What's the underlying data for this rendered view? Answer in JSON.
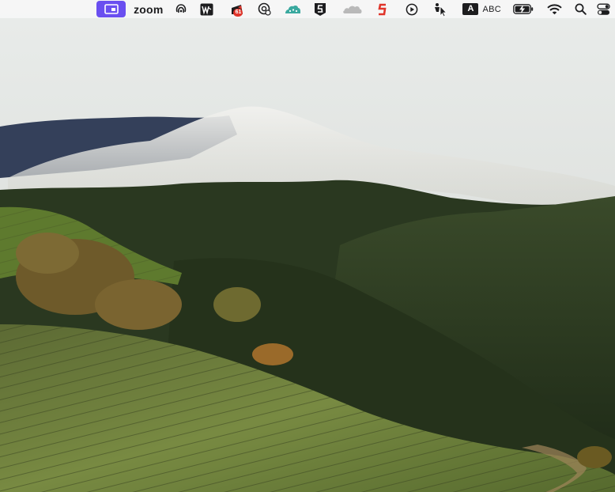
{
  "menubar": {
    "zoom_label": "zoom",
    "calendar_badge": "61",
    "input_source_letter": "A",
    "input_source_label": "ABC",
    "icons": [
      "screen-share-icon",
      "zoom-app-icon",
      "airpods-icon",
      "wps-office-icon",
      "calendar-icon",
      "vpn-shield-icon",
      "cloud-app-icon",
      "scrivener-icon",
      "soundcloud-icon",
      "s-app-icon",
      "play-circle-icon",
      "accessibility-cursor-icon",
      "input-source-icon",
      "battery-charging-icon",
      "wifi-icon",
      "spotlight-search-icon",
      "control-center-icon"
    ],
    "colors": {
      "bar_background": "#f6f6f6",
      "screen_share_accent": "#6a4ff0",
      "badge_red": "#e0352b",
      "s_app_red": "#e0352b",
      "cloud_teal": "#3aa99f"
    }
  },
  "desktop": {
    "wallpaper": "foggy-vineyard-hills"
  }
}
